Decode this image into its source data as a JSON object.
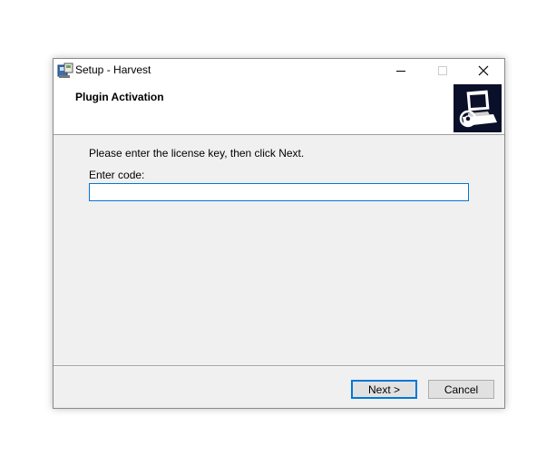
{
  "window": {
    "title": "Setup - Harvest"
  },
  "header": {
    "title": "Plugin Activation"
  },
  "content": {
    "instruction": "Please enter the license key, then click Next.",
    "code_label": "Enter code:",
    "code_value": "",
    "code_placeholder": ""
  },
  "buttons": {
    "next": "Next >",
    "cancel": "Cancel"
  },
  "colors": {
    "accent": "#0078d7",
    "dialog_bg": "#f0f0f0",
    "header_bg": "#ffffff",
    "wizard_image_bg": "#0a0f2a"
  },
  "icons": {
    "app": "installer-icon",
    "wizard": "computer-disk-icon"
  }
}
